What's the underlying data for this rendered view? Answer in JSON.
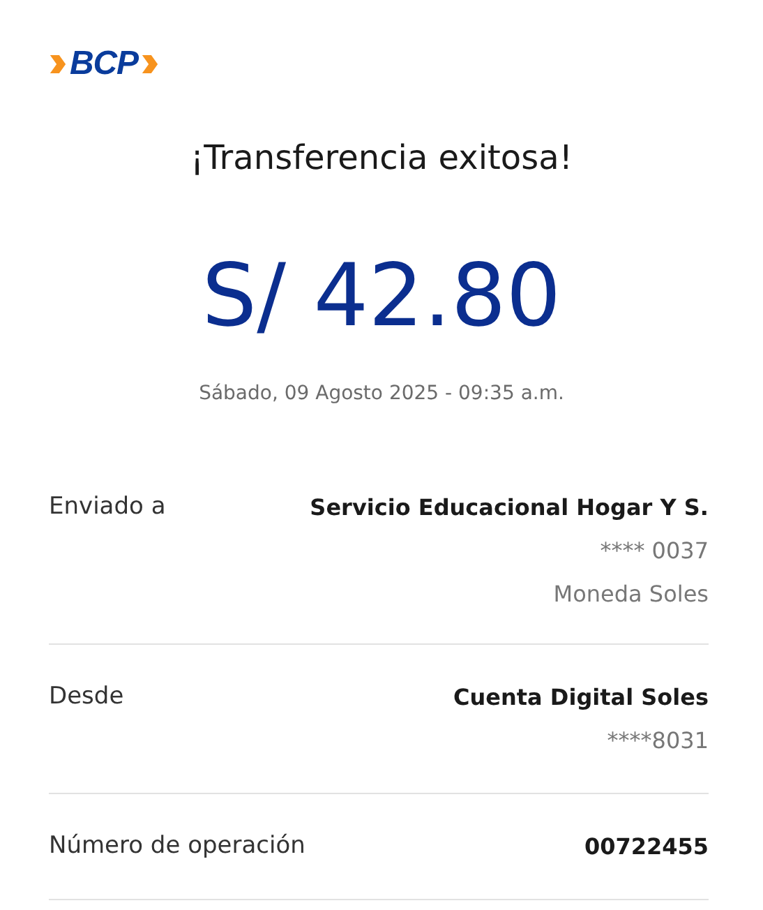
{
  "logo": {
    "text": "BCP"
  },
  "title": "¡Transferencia exitosa!",
  "amount": "S/ 42.80",
  "datetime": "Sábado, 09 Agosto 2025 - 09:35 a.m.",
  "details": [
    {
      "label": "Enviado a",
      "values": [
        {
          "text": "Servicio Educacional Hogar Y S.",
          "kind": "primary"
        },
        {
          "text": "**** 0037",
          "kind": "secondary"
        },
        {
          "text": "Moneda Soles",
          "kind": "secondary"
        }
      ]
    },
    {
      "label": "Desde",
      "values": [
        {
          "text": "Cuenta Digital Soles",
          "kind": "primary"
        },
        {
          "text": "****8031",
          "kind": "secondary"
        }
      ]
    },
    {
      "label": "Número de operación",
      "values": [
        {
          "text": "00722455",
          "kind": "primary"
        }
      ]
    }
  ]
}
